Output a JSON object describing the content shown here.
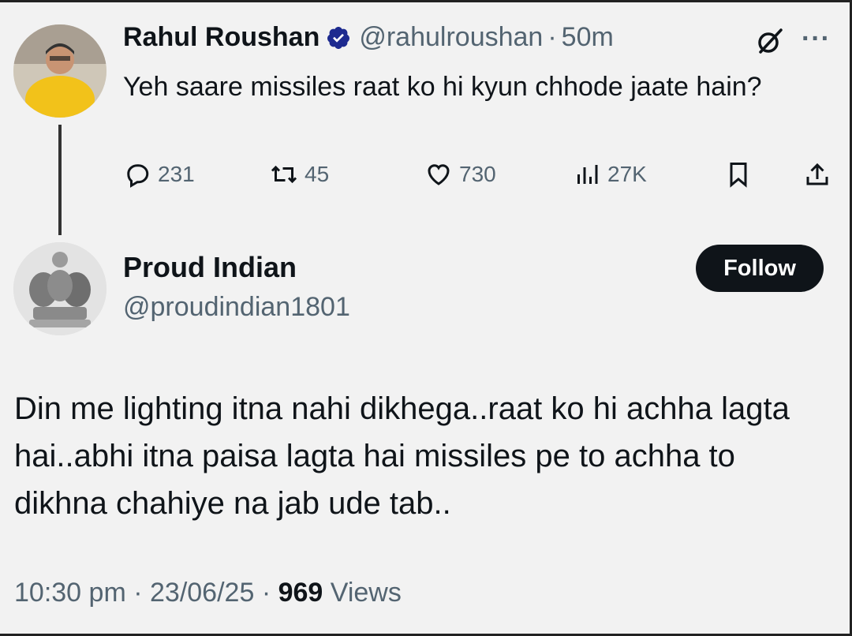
{
  "original_tweet": {
    "author_name": "Rahul Roushan",
    "handle": "@rahulroushan",
    "separator": "·",
    "time": "50m",
    "text": "Yeh saare missiles raat ko hi kyun chhode jaate hain?",
    "more_label": "···",
    "stats": {
      "replies": "231",
      "reposts": "45",
      "likes": "730",
      "views": "27K"
    }
  },
  "reply": {
    "author_name": "Proud Indian",
    "handle": "@proudindian1801",
    "follow_label": "Follow",
    "text": "Din me lighting itna nahi dikhega..raat ko hi achha lagta hai..abhi itna paisa lagta hai missiles pe to achha to dikhna chahiye na jab ude tab..",
    "time": "10:30 pm",
    "date": "23/06/25",
    "separator": "·",
    "views_count": "969",
    "views_label": "Views"
  },
  "colors": {
    "background": "#f2f2f2",
    "text_primary": "#0f1419",
    "text_secondary": "#536471",
    "verified_badge": "#1d2a8f",
    "follow_button": "#0f1419"
  },
  "icons": [
    "verified-badge-icon",
    "grok-icon",
    "more-icon",
    "reply-icon",
    "repost-icon",
    "like-icon",
    "views-icon",
    "bookmark-icon",
    "share-icon"
  ]
}
